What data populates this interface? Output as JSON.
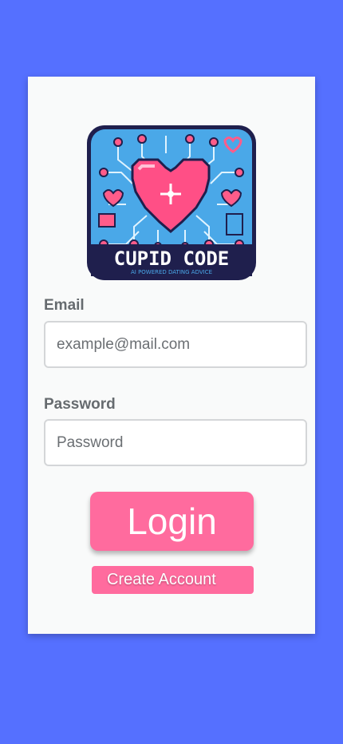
{
  "logo": {
    "title": "CUPID CODE",
    "tagline": "AI POWERED DATING ADVICE"
  },
  "login_form": {
    "email_label": "Email",
    "email_placeholder": "example@mail.com",
    "password_label": "Password",
    "password_placeholder": "Password",
    "login_label": "Login",
    "create_account_label": "Create Account"
  },
  "colors": {
    "background": "#5570ff",
    "card": "#f9fafa",
    "accent_pink": "#ff6b9e",
    "logo_blue": "#4aa8e8",
    "logo_navy": "#1f1f4d"
  }
}
